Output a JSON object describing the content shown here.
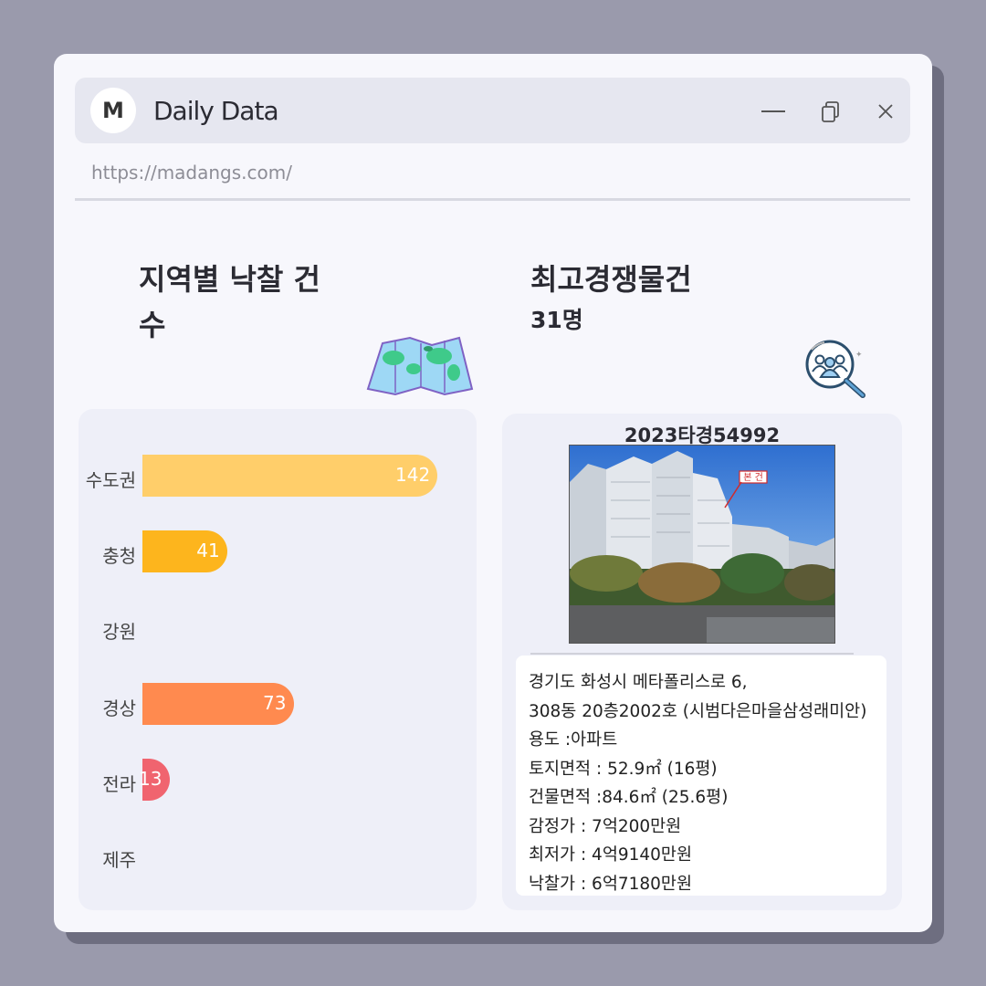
{
  "window": {
    "logo_letter": "M",
    "title": "Daily Data",
    "url": "https://madangs.com/"
  },
  "left_panel": {
    "title": "지역별 낙찰 건수",
    "icon": "map-icon"
  },
  "right_panel": {
    "title": "최고경쟁물건",
    "subtitle": "31명",
    "icon": "search-people-icon",
    "case_number": "2023타경54992",
    "photo_tag": "본 건",
    "info": [
      "경기도 화성시 메타폴리스로 6,",
      "308동 20층2002호 (시범다은마을삼성래미안)",
      "용도 :아파트",
      "토지면적 : 52.9㎡ (16평)",
      "건물면적 :84.6㎡ (25.6평)",
      "감정가 : 7억200만원",
      "최저가 : 4억9140만원",
      "낙찰가 : 6억7180만원"
    ]
  },
  "chart_data": {
    "type": "bar",
    "orientation": "horizontal",
    "categories": [
      "수도권",
      "충청",
      "강원",
      "경상",
      "전라",
      "제주"
    ],
    "values": [
      142,
      41,
      0,
      73,
      13,
      0
    ],
    "value_labels": [
      "142",
      "41",
      "",
      "73",
      "13",
      ""
    ],
    "colors": [
      "#ffce6a",
      "#fdb51d",
      "#fdb51d",
      "#ff8a4f",
      "#f0646f",
      "#f0646f"
    ],
    "xlim": [
      0,
      142
    ],
    "grid": false
  },
  "colors": {
    "background": "#9a9aac",
    "window": "#f7f7fc",
    "panel": "#eeeff8"
  }
}
